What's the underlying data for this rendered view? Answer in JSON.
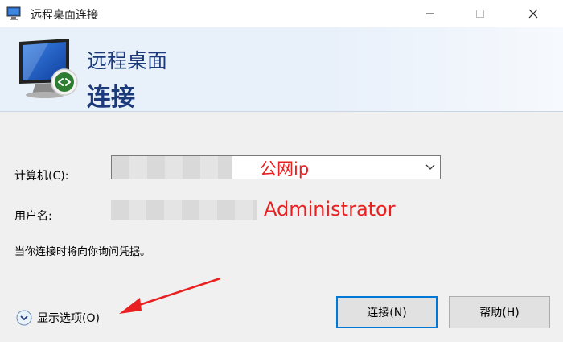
{
  "window": {
    "title": "远程桌面连接",
    "minimize": "—",
    "maximize": "☐",
    "close": "✕"
  },
  "banner": {
    "line1": "远程桌面",
    "line2": "连接"
  },
  "form": {
    "computer_label": "计算机(C):",
    "computer_annotation": "公网ip",
    "user_label": "用户名:",
    "user_annotation": "Administrator",
    "info": "当你连接时将向你询问凭据。"
  },
  "footer": {
    "options_label": "显示选项(O)",
    "connect_label": "连接(N)",
    "help_label": "帮助(H)"
  },
  "colors": {
    "banner_text": "#1c3a7a",
    "annotation_red": "#e82020",
    "focus_border": "#0078d7"
  }
}
